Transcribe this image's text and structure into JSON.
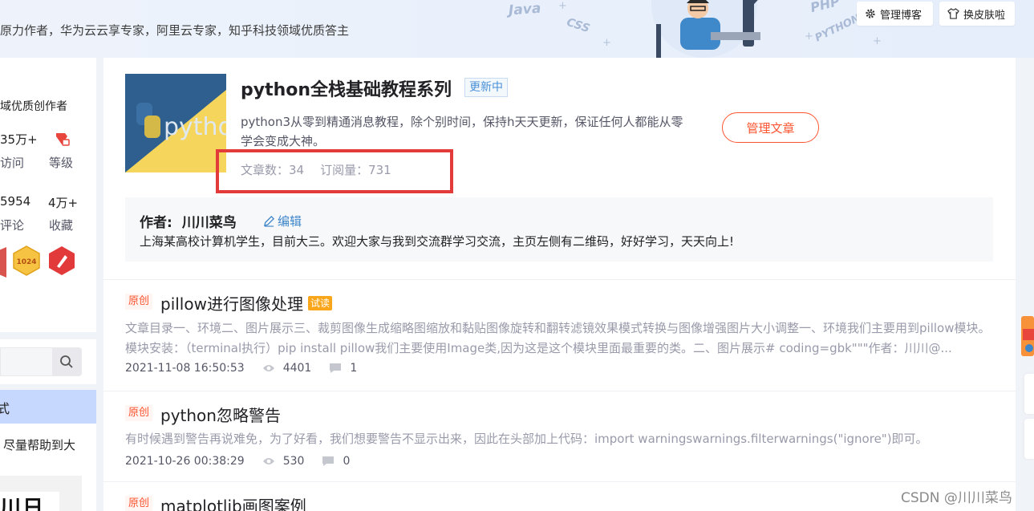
{
  "banner": {
    "intro": "原力作者，华为云云享专家，阿里云专家，知乎科技领域优质答主",
    "deco_words": [
      "Java",
      "CSS",
      "PHP",
      "PYTHON"
    ],
    "manage_blog": "管理博客",
    "change_skin": "换皮肤啦"
  },
  "left_profile": {
    "author_tag": "域优质创作者",
    "stats": [
      {
        "value": "35万+",
        "label": "访问"
      },
      {
        "value": "",
        "label": "等级"
      },
      {
        "value": "5954",
        "label": "评论"
      },
      {
        "value": "4万+",
        "label": "收藏"
      }
    ],
    "badges": [
      "badge-a",
      "1024",
      "pen-badge"
    ]
  },
  "left_nav": {
    "active_item": "式",
    "description": "尽量帮助到大",
    "qr_text": "川日"
  },
  "column": {
    "cover_text": "python",
    "title": "python全栈基础教程系列",
    "status": "更新中",
    "description": "python3从零到精通消息教程，除个别时间，保持h天天更新，保证任何人都能从零学会变成大神。",
    "article_count_label": "文章数：34",
    "subscribe_label": "订阅量：731",
    "manage_button": "管理文章"
  },
  "author": {
    "label": "作者:",
    "name": "川川菜鸟",
    "edit": "编辑",
    "bio": "上海某高校计算机学生，目前大三。欢迎大家与我到交流群学习交流，主页左侧有二维码，好好学习，天天向上!"
  },
  "articles": [
    {
      "tag": "原创",
      "title": "pillow进行图像处理",
      "badge": "试读",
      "desc": "文章目录一、环境二、图片展示三、裁剪图像生成缩略图缩放和黏贴图像旋转和翻转滤镜效果模式转换与图像增强图片大小调整一、环境我们主要用到pillow模块。模块安装：（terminal执行）pip install pillow我们主要使用Image类,因为这是这个模块里面最重要的类。二、图片展示# coding=gbk\"\"\"作者：川川@...",
      "date": "2021-11-08 16:50:53",
      "views": "4401",
      "comments": "1"
    },
    {
      "tag": "原创",
      "title": "python忽略警告",
      "badge": "",
      "desc": "有时候遇到警告再说难免，为了好看，我们想要警告不显示出来，因此在头部加上代码：import warningswarnings.filterwarnings(\"ignore\")即可。",
      "date": "2021-10-26 00:38:29",
      "views": "530",
      "comments": "0"
    },
    {
      "tag": "原创",
      "title": "matplotlib画图案例",
      "badge": "",
      "desc": "",
      "date": "",
      "views": "",
      "comments": ""
    }
  ],
  "watermark": "CSDN @川川菜鸟",
  "colors": {
    "accent_red": "#fc5531",
    "highlight_box": "#e33a3a",
    "link_blue": "#3e86ca",
    "trial_orange": "#f9a61a"
  }
}
